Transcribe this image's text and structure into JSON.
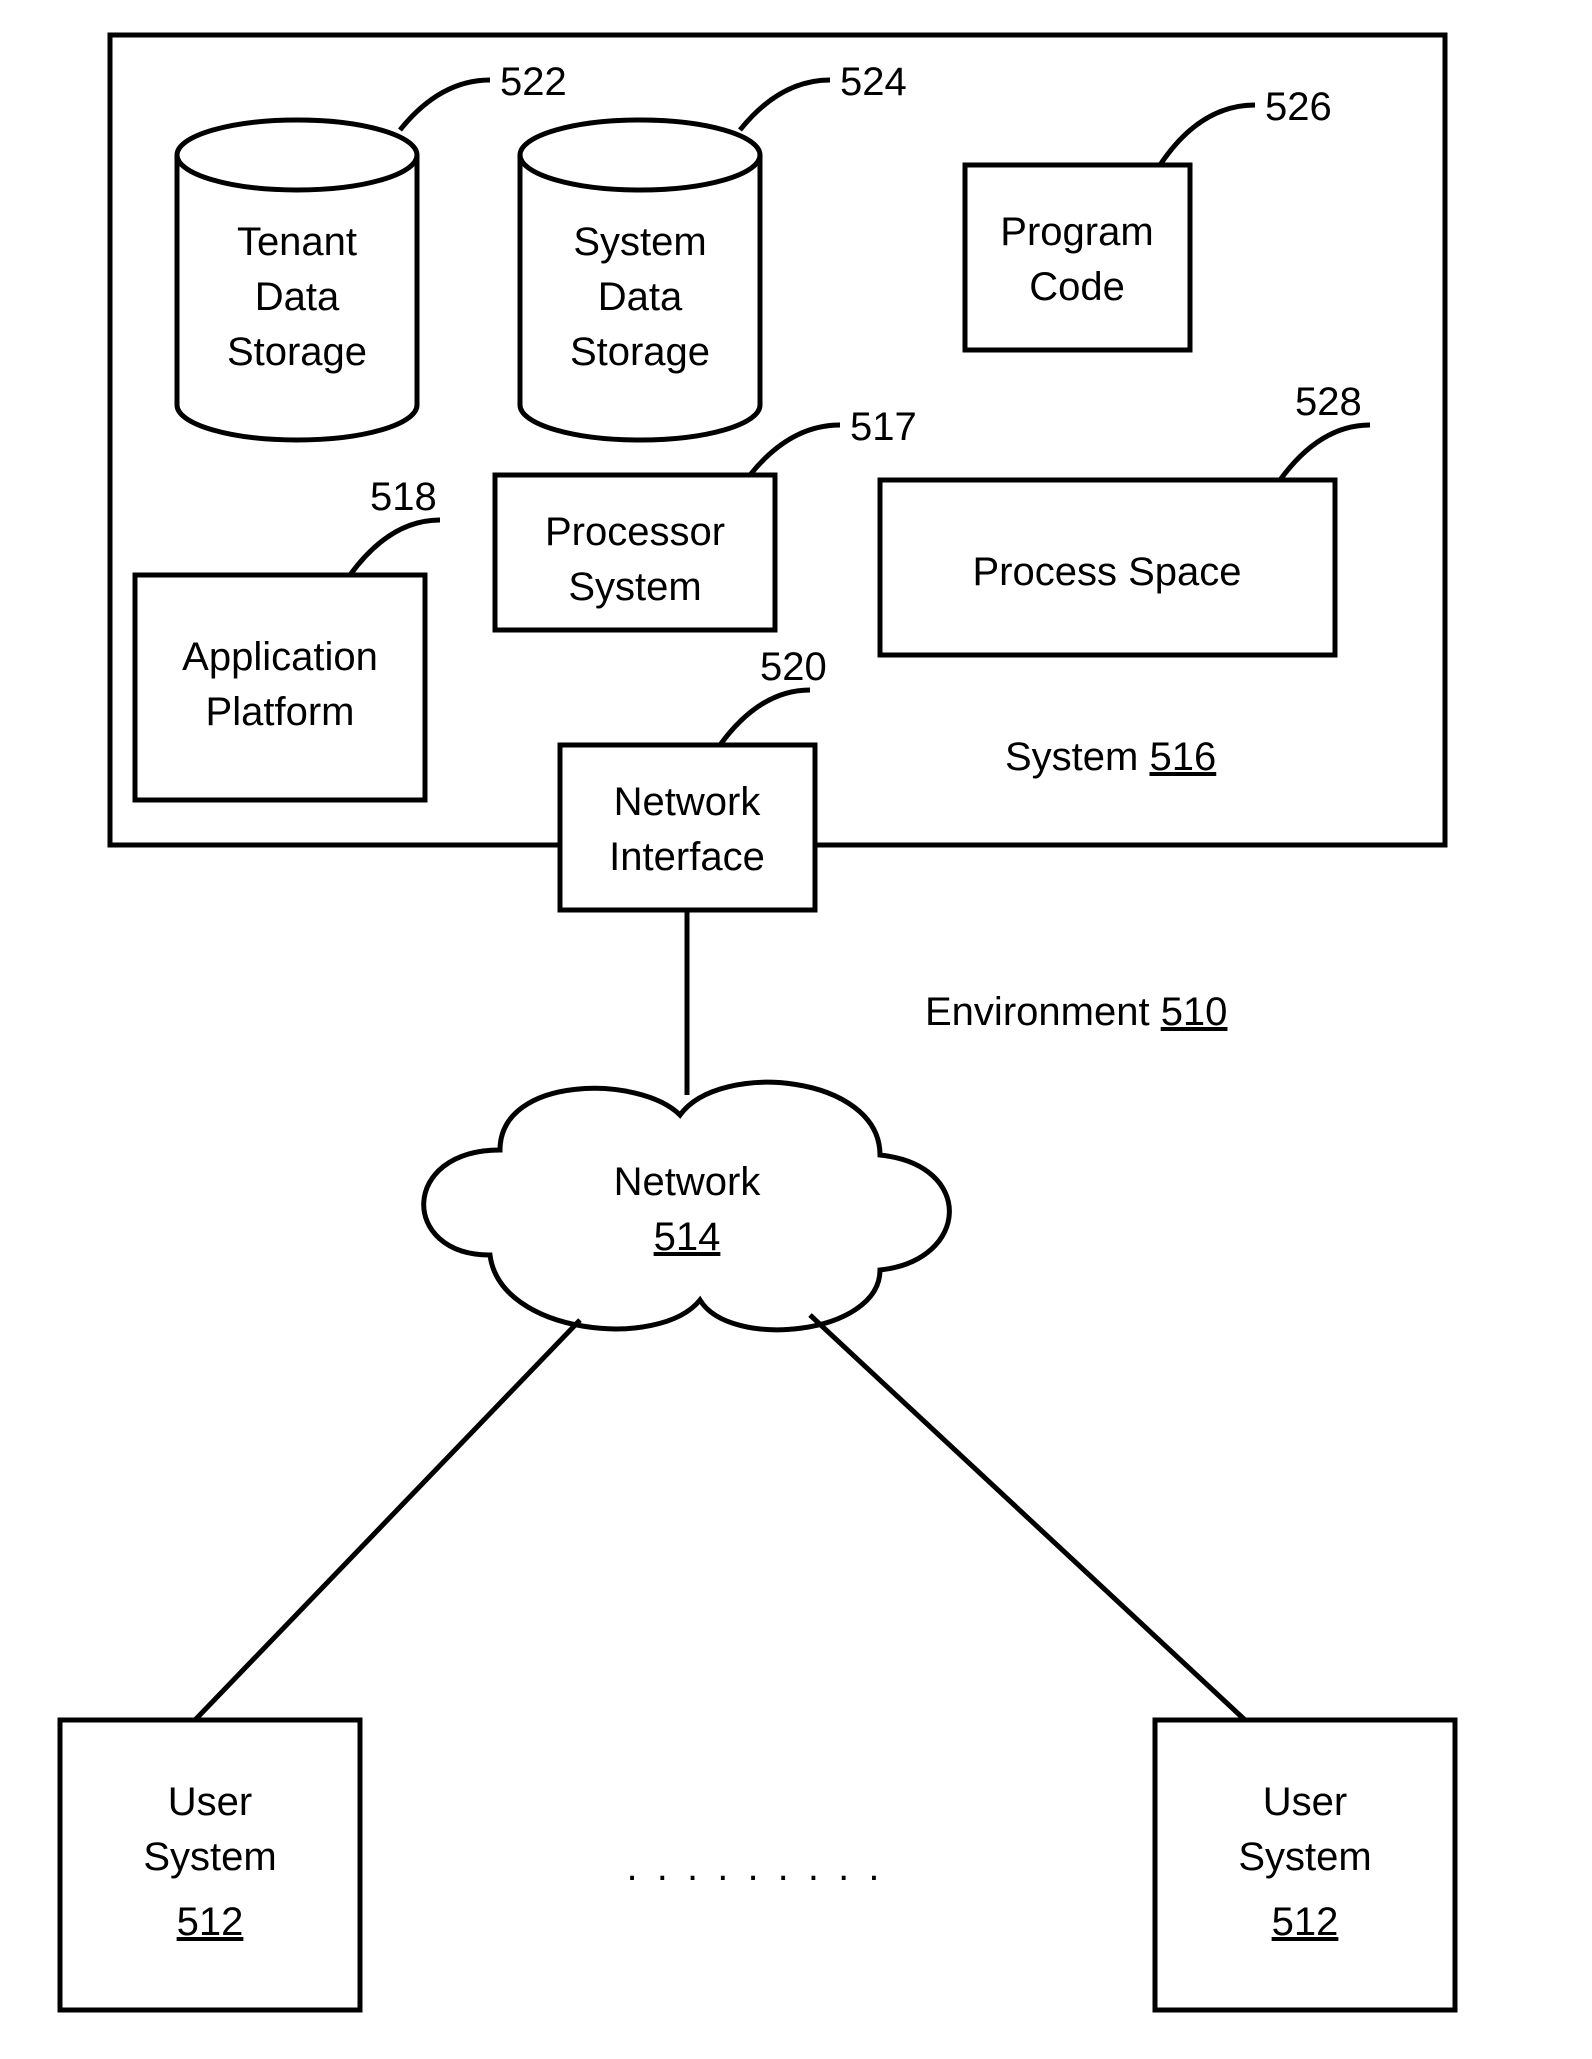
{
  "refs": {
    "tenant": "522",
    "systemData": "524",
    "programCode": "526",
    "processor": "517",
    "appPlatform": "518",
    "processSpace": "528",
    "networkInterface": "520",
    "system": "516",
    "environment": "510",
    "network": "514",
    "userSystem": "512"
  },
  "labels": {
    "tenant1": "Tenant",
    "tenant2": "Data",
    "tenant3": "Storage",
    "systemData1": "System",
    "systemData2": "Data",
    "systemData3": "Storage",
    "programCode1": "Program",
    "programCode2": "Code",
    "processor1": "Processor",
    "processor2": "System",
    "appPlatform1": "Application",
    "appPlatform2": "Platform",
    "processSpace": "Process Space",
    "networkInterface1": "Network",
    "networkInterface2": "Interface",
    "systemLabel": "System",
    "environmentLabel": "Environment",
    "network": "Network",
    "user1": "User",
    "user2": "System",
    "ellipsis": ". . . . . . . . ."
  }
}
